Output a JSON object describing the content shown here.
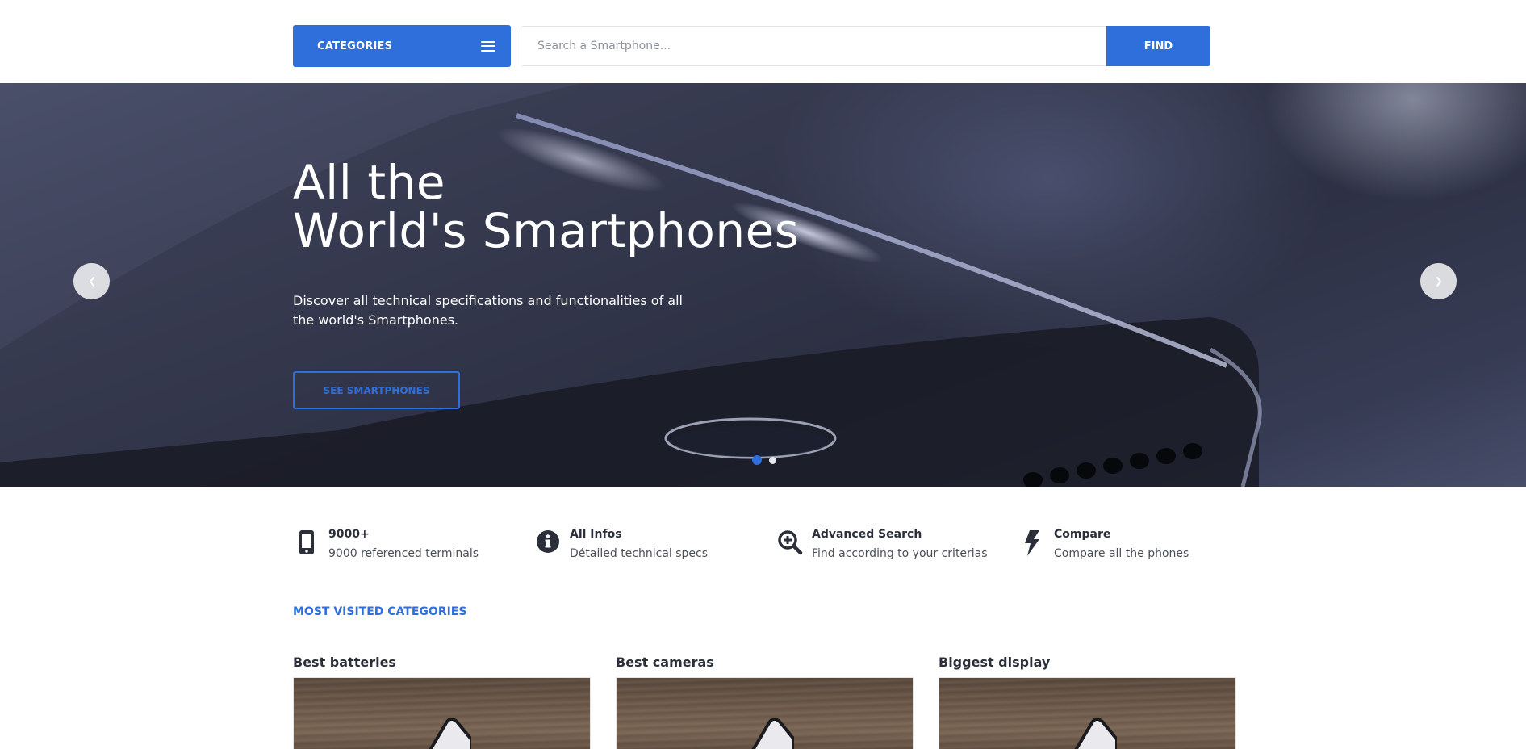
{
  "header": {
    "categories_label": "CATEGORIES",
    "search_placeholder": "Search a Smartphone...",
    "find_label": "FIND",
    "accent_color": "#2f6fdb"
  },
  "hero": {
    "title_line1": "All the",
    "title_line2": "World's Smartphones",
    "subtitle": "Discover all technical specifications and functionalities of all the world's Smartphones.",
    "cta_label": "SEE SMARTPHONES",
    "prev_icon": "chevron-left-icon",
    "next_icon": "chevron-right-icon",
    "slides": {
      "count": 2,
      "active": 1
    }
  },
  "features": [
    {
      "icon": "smartphone-icon",
      "title": "9000+",
      "text": "9000 referenced terminals"
    },
    {
      "icon": "info-icon",
      "title": "All Infos",
      "text": "Détailed technical specs"
    },
    {
      "icon": "zoom-in-icon",
      "title": "Advanced Search",
      "text": "Find according to your criterias"
    },
    {
      "icon": "bolt-icon",
      "title": "Compare",
      "text": "Compare all the phones"
    }
  ],
  "section_title": "MOST VISITED CATEGORIES",
  "categories": [
    {
      "title": "Best batteries"
    },
    {
      "title": "Best cameras"
    },
    {
      "title": "Biggest display"
    }
  ]
}
